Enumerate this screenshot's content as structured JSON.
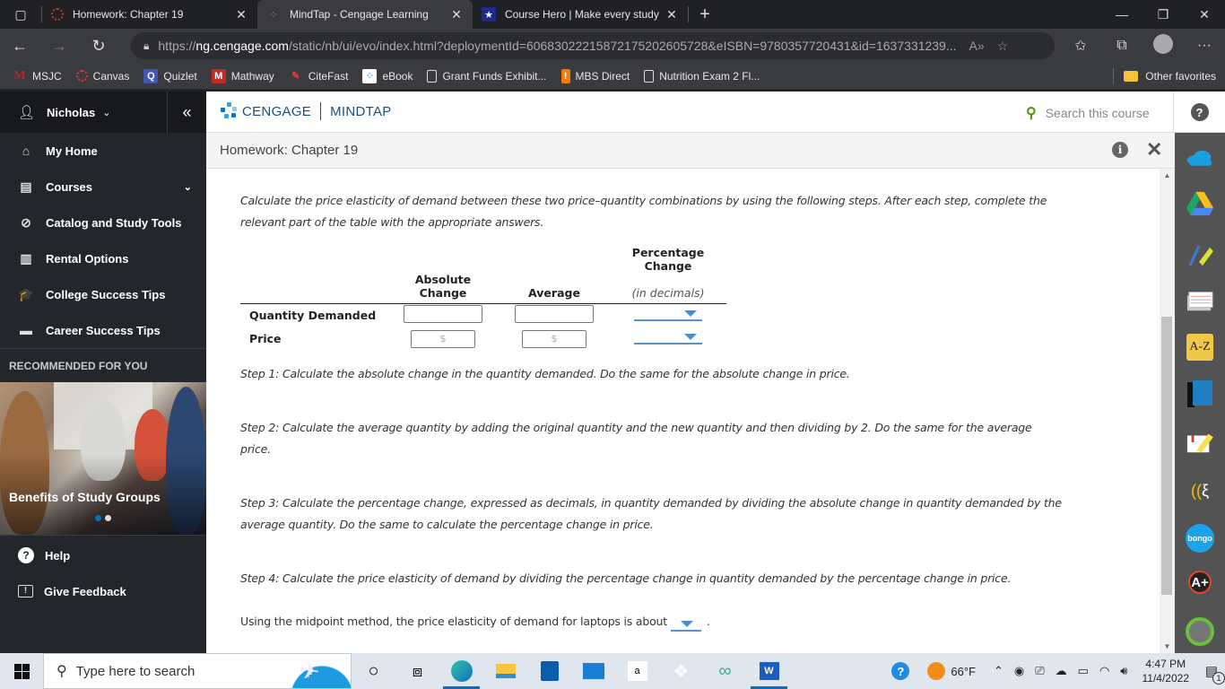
{
  "browser": {
    "tabs": [
      {
        "title": "Homework: Chapter 19",
        "icon": "canvas-icon",
        "active": false
      },
      {
        "title": "MindTap - Cengage Learning",
        "icon": "cengage-icon",
        "active": true
      },
      {
        "title": "Course Hero | Make every study",
        "icon": "coursehero-icon",
        "active": false
      }
    ],
    "tab_close_glyph": "✕",
    "new_tab_glyph": "+",
    "url_prefix": "https://",
    "url_host": "ng.cengage.com",
    "url_rest": "/static/nb/ui/evo/index.html?deploymentId=60683022215872175202605728&eISBN=9780357720431&id=1637331239...",
    "bookmarks": [
      {
        "label": "MSJC",
        "icon": "msjc-icon"
      },
      {
        "label": "Canvas",
        "icon": "canvas-icon"
      },
      {
        "label": "Quizlet",
        "icon": "quizlet-icon"
      },
      {
        "label": "Mathway",
        "icon": "mathway-icon"
      },
      {
        "label": "CiteFast",
        "icon": "citefast-icon"
      },
      {
        "label": "eBook",
        "icon": "ebook-icon"
      },
      {
        "label": "Grant Funds Exhibit...",
        "icon": "page-icon"
      },
      {
        "label": "MBS Direct",
        "icon": "mbs-icon"
      },
      {
        "label": "Nutrition Exam 2 Fl...",
        "icon": "page-icon"
      }
    ],
    "other_favorites": "Other favorites"
  },
  "sidebar": {
    "user_name": "Nicholas",
    "collapse_glyph": "«",
    "nav_items": [
      {
        "label": "My Home",
        "icon": "home-icon",
        "glyph": "⌂"
      },
      {
        "label": "Courses",
        "icon": "book-icon",
        "glyph": "▤",
        "expandable": true
      },
      {
        "label": "Catalog and Study Tools",
        "icon": "compass-icon",
        "glyph": "⊘"
      },
      {
        "label": "Rental Options",
        "icon": "open-book-icon",
        "glyph": "▥"
      },
      {
        "label": "College Success Tips",
        "icon": "graduation-cap-icon",
        "glyph": "🎓"
      },
      {
        "label": "Career Success Tips",
        "icon": "briefcase-icon",
        "glyph": "▬"
      }
    ],
    "recommended_title": "RECOMMENDED FOR YOU",
    "recommended_card": {
      "title": "Benefits of Study Groups",
      "slide": 1,
      "slides": 2
    },
    "bottom_items": [
      {
        "label": "Help",
        "icon": "help-circle-icon",
        "glyph": "?"
      },
      {
        "label": "Give Feedback",
        "icon": "feedback-icon",
        "glyph": "!"
      }
    ]
  },
  "header": {
    "logo_left": "CENGAGE",
    "logo_right": "MINDTAP",
    "search_placeholder": "Search this course",
    "help_glyph": "?"
  },
  "activity": {
    "title": "Homework: Chapter 19",
    "info_glyph": "i",
    "close_glyph": "✕"
  },
  "content": {
    "intro_line1": "Calculate the price elasticity of demand between these two price–quantity combinations by using the following steps. After each step, complete the",
    "intro_line2": "relevant part of the table with the appropriate answers.",
    "table": {
      "col_pct_top": "Percentage Change",
      "col_abs": "Absolute Change",
      "col_avg": "Average",
      "col_pct_sub": "(in decimals)",
      "rows": [
        {
          "label": "Quantity Demanded",
          "abs_value": "",
          "avg_value": "",
          "abs_placeholder": "",
          "avg_placeholder": "",
          "pct_selected": ""
        },
        {
          "label": "Price",
          "abs_value": "",
          "avg_value": "",
          "abs_placeholder": "$",
          "avg_placeholder": "$",
          "pct_selected": ""
        }
      ]
    },
    "step1": "Step 1: Calculate the absolute change in the quantity demanded. Do the same for the absolute change in price.",
    "step2_line1": "Step 2: Calculate the average quantity by adding the original quantity and the new quantity and then dividing by 2. Do the same for the average",
    "step2_line2": "price.",
    "step3_line1": "Step 3: Calculate the percentage change, expressed as decimals, in quantity demanded by dividing the absolute change in quantity demanded by the",
    "step3_line2": "average quantity. Do the same to calculate the percentage change in price.",
    "step4": "Step 4: Calculate the price elasticity of demand by dividing the percentage change in quantity demanded by the percentage change in price.",
    "conclusion": "Using the midpoint method, the price elasticity of demand for laptops is about",
    "conclusion_end": ".",
    "conclusion_selected": ""
  },
  "tools": [
    {
      "name": "onedrive-icon",
      "color": "#1a9fe0"
    },
    {
      "name": "google-drive-icon",
      "color": "#1fa463"
    },
    {
      "name": "highlighter-icon",
      "color": "#d8e23a"
    },
    {
      "name": "flashcards-icon",
      "color": "#ffffff"
    },
    {
      "name": "glossary-icon",
      "label": "A-Z",
      "color": "#f2c84b"
    },
    {
      "name": "notebook-icon",
      "color": "#1f7fc2"
    },
    {
      "name": "notes-icon",
      "color": "#f6e24b"
    },
    {
      "name": "readspeaker-icon",
      "color": "#f2c200"
    },
    {
      "name": "bongo-icon",
      "label": "bongo",
      "color": "#1aa3e8"
    },
    {
      "name": "aplus-icon",
      "label": "A+",
      "color": "#e0472b"
    },
    {
      "name": "profile-icon",
      "color": "#6abf3c"
    }
  ],
  "taskbar": {
    "search_placeholder": "Type here to search",
    "weather": "66°F",
    "time": "4:47 PM",
    "date": "11/4/2022",
    "notification_count": "1"
  }
}
